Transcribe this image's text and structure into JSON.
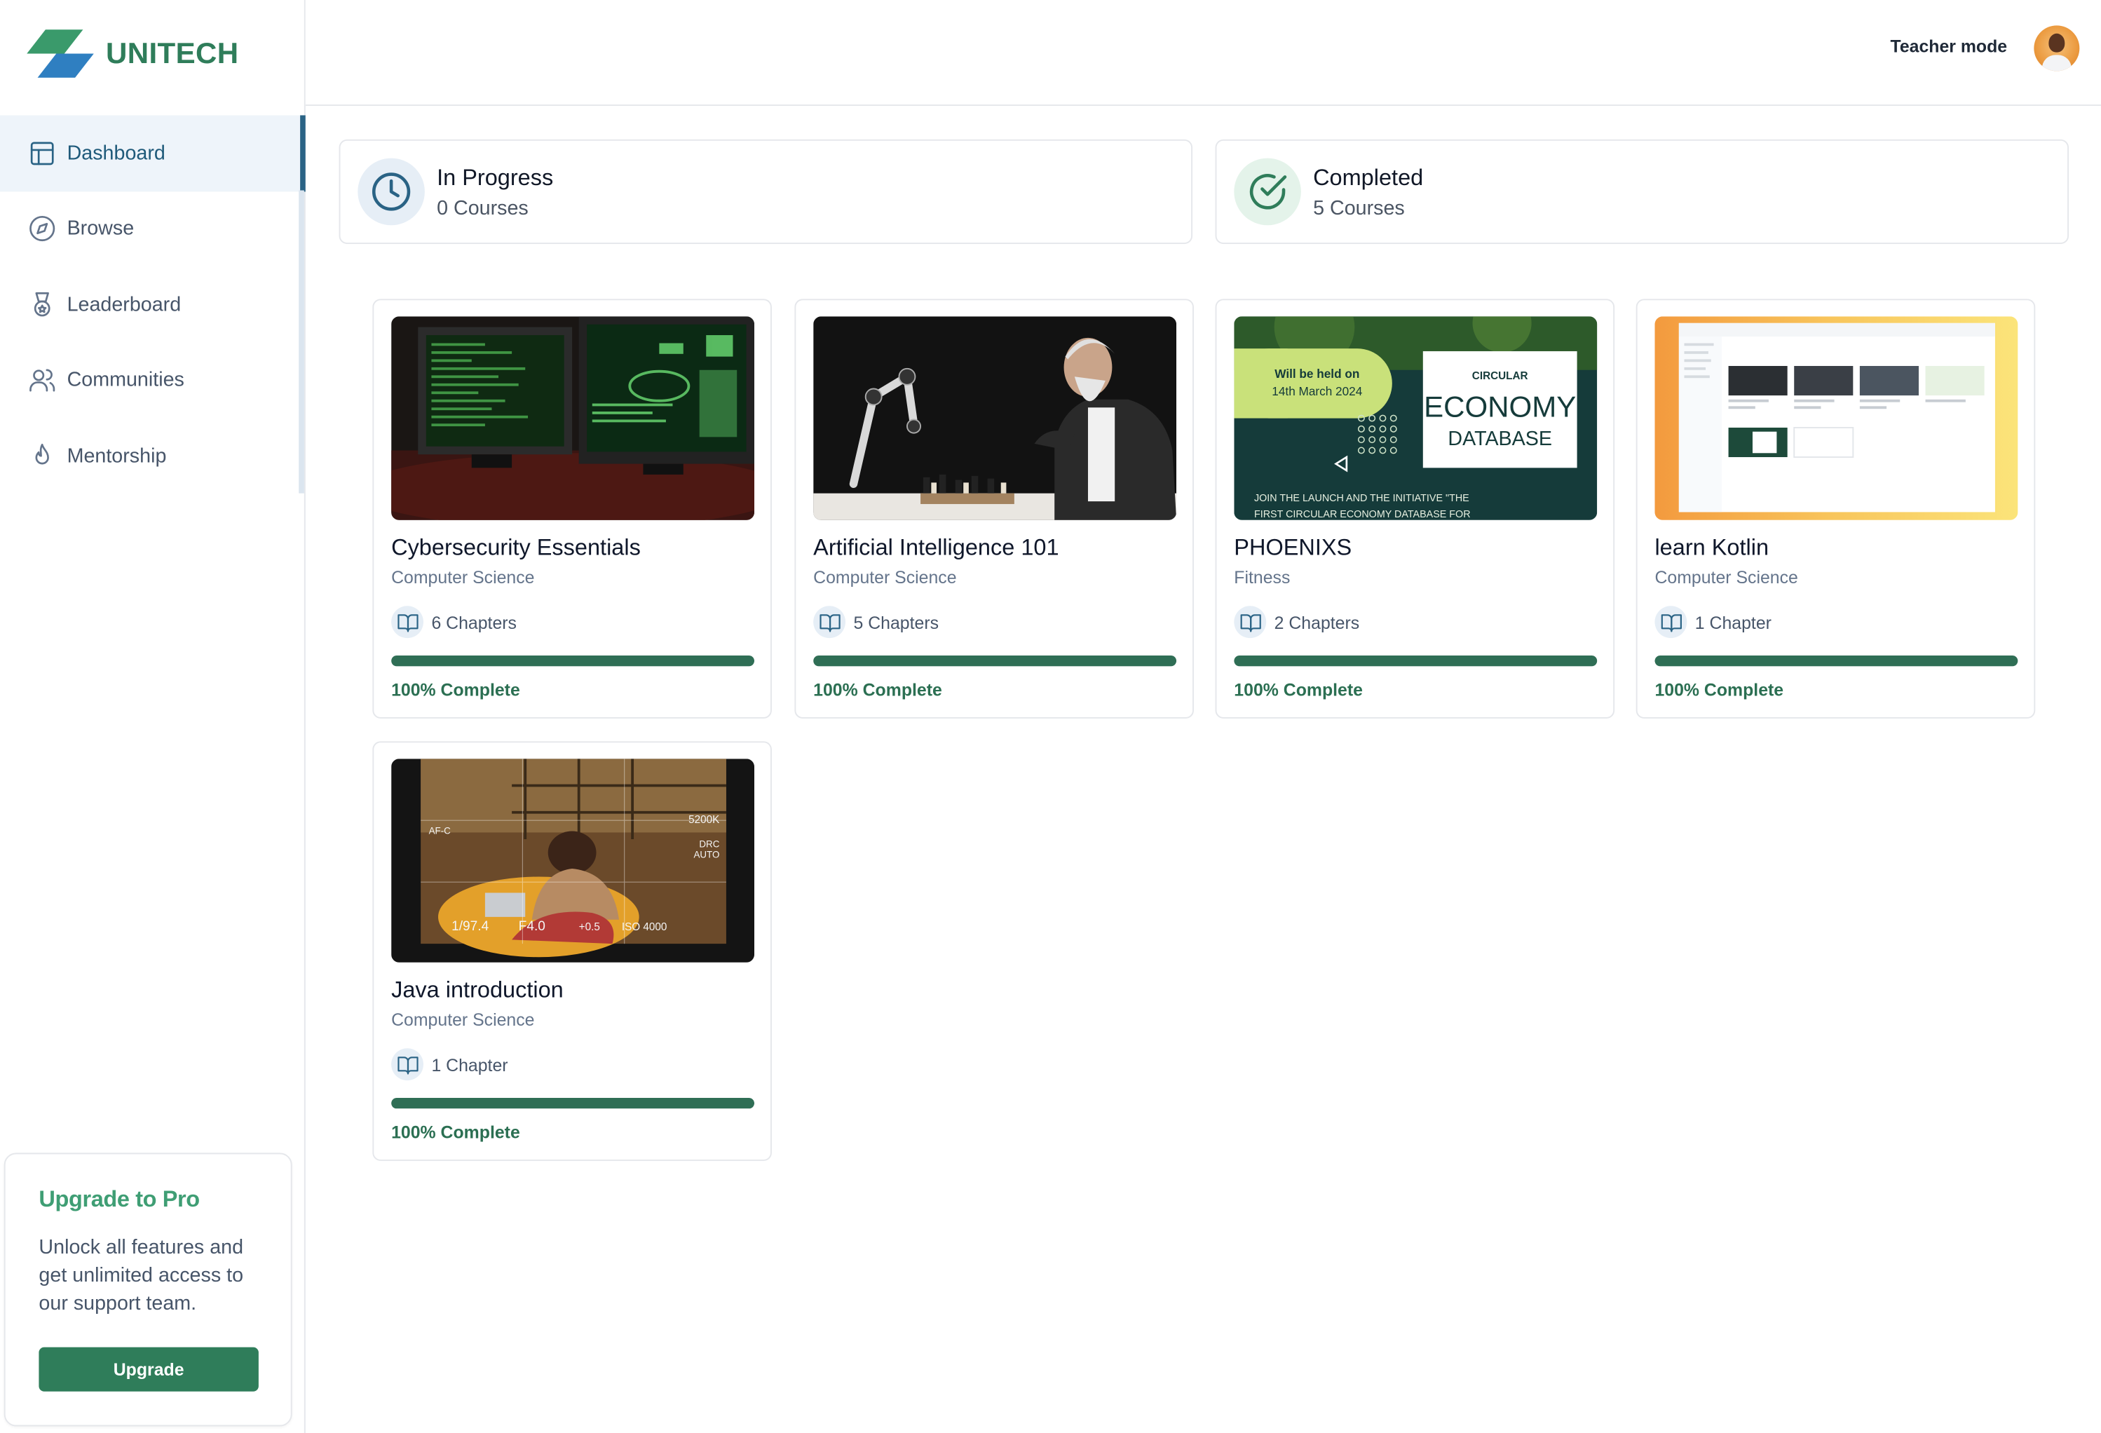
{
  "brand": {
    "name": "UNITECH"
  },
  "sidebar": {
    "items": [
      {
        "label": "Dashboard",
        "icon": "layout-icon",
        "active": true
      },
      {
        "label": "Browse",
        "icon": "compass-icon",
        "active": false
      },
      {
        "label": "Leaderboard",
        "icon": "medal-icon",
        "active": false
      },
      {
        "label": "Communities",
        "icon": "users-icon",
        "active": false
      },
      {
        "label": "Mentorship",
        "icon": "flame-icon",
        "active": false
      }
    ],
    "upgrade": {
      "title": "Upgrade to Pro",
      "text": "Unlock all features and get unlimited access to our support team.",
      "button": "Upgrade"
    }
  },
  "header": {
    "mode_label": "Teacher mode"
  },
  "stats": {
    "in_progress": {
      "title": "In Progress",
      "count": "0 Courses",
      "icon": "clock-icon",
      "color": "#2a6385"
    },
    "completed": {
      "title": "Completed",
      "count": "5 Courses",
      "icon": "check-circle-icon",
      "color": "#2f7d5a"
    }
  },
  "courses": [
    {
      "title": "Cybersecurity Essentials",
      "category": "Computer Science",
      "chapters": "6 Chapters",
      "progress": 1.0,
      "progress_label": "100% Complete"
    },
    {
      "title": "Artificial Intelligence 101",
      "category": "Computer Science",
      "chapters": "5 Chapters",
      "progress": 1.0,
      "progress_label": "100% Complete"
    },
    {
      "title": "PHOENIXS",
      "category": "Fitness",
      "chapters": "2 Chapters",
      "progress": 1.0,
      "progress_label": "100% Complete",
      "thumb_text": {
        "date_line1": "Will be held on",
        "date_line2": "14th March 2024",
        "small": "CIRCULAR",
        "big": "ECONOMY",
        "mid": "DATABASE",
        "foot1": "JOIN THE LAUNCH AND THE INITIATIVE \"THE",
        "foot2": "FIRST CIRCULAR ECONOMY DATABASE FOR"
      }
    },
    {
      "title": "learn Kotlin",
      "category": "Computer Science",
      "chapters": "1 Chapter",
      "progress": 1.0,
      "progress_label": "100% Complete"
    },
    {
      "title": "Java introduction",
      "category": "Computer Science",
      "chapters": "1 Chapter",
      "progress": 1.0,
      "progress_label": "100% Complete",
      "thumb_text": {
        "k": "5200K",
        "drc": "DRC",
        "auto": "AUTO",
        "afc": "AF-C",
        "shutter": "1/97.4",
        "f": "F4.0",
        "ev": "+0.5",
        "iso": "ISO 4000"
      }
    }
  ],
  "colors": {
    "brand_green": "#2f7d5a",
    "brand_blue": "#2a6385",
    "progress_fill": "#2f6e55"
  }
}
